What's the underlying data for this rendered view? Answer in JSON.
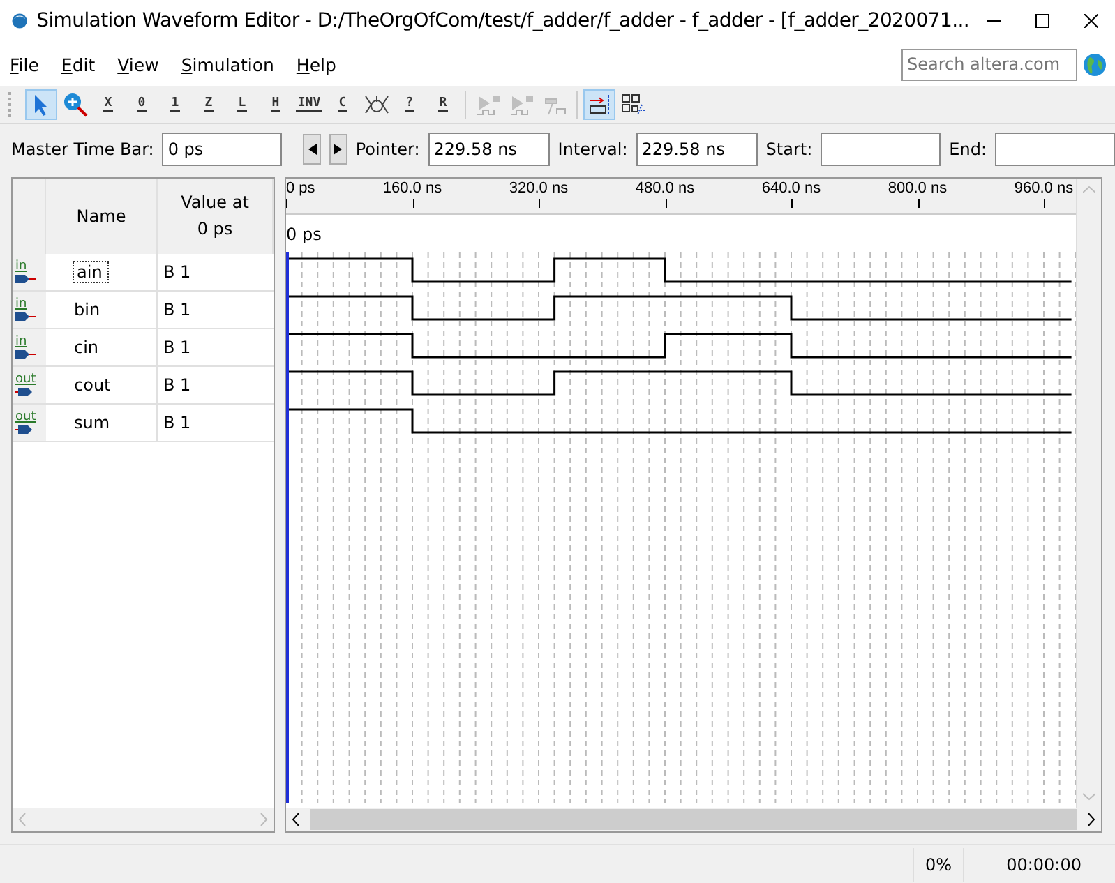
{
  "window": {
    "title": "Simulation Waveform Editor - D:/TheOrgOfCom/test/f_adder/f_adder - f_adder - [f_adder_2020071..."
  },
  "menu": [
    {
      "label": "File"
    },
    {
      "label": "Edit"
    },
    {
      "label": "View"
    },
    {
      "label": "Simulation"
    },
    {
      "label": "Help"
    }
  ],
  "search": {
    "placeholder": "Search altera.com"
  },
  "toolbar": [
    {
      "kind": "pointer",
      "selected": true,
      "disabled": false
    },
    {
      "kind": "zoom",
      "selected": false,
      "disabled": false
    },
    {
      "kind": "glyph",
      "glyph": "X",
      "selected": false,
      "disabled": false
    },
    {
      "kind": "glyph",
      "glyph": "0",
      "selected": false,
      "disabled": false
    },
    {
      "kind": "glyph",
      "glyph": "1",
      "selected": false,
      "disabled": false
    },
    {
      "kind": "glyph",
      "glyph": "Z",
      "selected": false,
      "disabled": false
    },
    {
      "kind": "glyph",
      "glyph": "L",
      "selected": false,
      "disabled": false
    },
    {
      "kind": "glyph",
      "glyph": "H",
      "selected": false,
      "disabled": false
    },
    {
      "kind": "glyph",
      "glyph": "INV",
      "selected": false,
      "disabled": false
    },
    {
      "kind": "glyph",
      "glyph": "C",
      "selected": false,
      "disabled": false
    },
    {
      "kind": "clock",
      "selected": false,
      "disabled": false
    },
    {
      "kind": "glyph",
      "glyph": "?",
      "selected": false,
      "disabled": false
    },
    {
      "kind": "glyph",
      "glyph": "R",
      "selected": false,
      "disabled": false
    },
    {
      "kind": "sep"
    },
    {
      "kind": "run",
      "selected": false,
      "disabled": true
    },
    {
      "kind": "run",
      "selected": false,
      "disabled": true
    },
    {
      "kind": "hammer",
      "selected": false,
      "disabled": true
    },
    {
      "kind": "sep"
    },
    {
      "kind": "snap",
      "selected": true,
      "disabled": false
    },
    {
      "kind": "grid",
      "selected": false,
      "disabled": false
    }
  ],
  "timebar": {
    "master_label": "Master Time Bar:",
    "master_value": "0 ps",
    "pointer_label": "Pointer:",
    "pointer_value": "229.58 ns",
    "interval_label": "Interval:",
    "interval_value": "229.58 ns",
    "start_label": "Start:",
    "end_label": "End:"
  },
  "signals_table": {
    "columns": [
      "Name",
      "Value at\n0 ps"
    ],
    "rows": [
      {
        "kind": "input",
        "pin_label": "in",
        "name": "ain",
        "value": "B 1",
        "selected": true
      },
      {
        "kind": "input",
        "pin_label": "in",
        "name": "bin",
        "value": "B 1",
        "selected": false
      },
      {
        "kind": "input",
        "pin_label": "in",
        "name": "cin",
        "value": "B 1",
        "selected": false
      },
      {
        "kind": "output",
        "pin_label": "out",
        "name": "cout",
        "value": "B 1",
        "selected": false
      },
      {
        "kind": "output",
        "pin_label": "out",
        "name": "sum",
        "value": "B 1",
        "selected": false
      }
    ]
  },
  "waveform": {
    "ruler": [
      "0 ps",
      "160.0 ns",
      "320.0 ns",
      "480.0 ns",
      "640.0 ns",
      "800.0 ns",
      "960.0 ns"
    ],
    "cursor_label": "0 ps"
  },
  "status_bar": {
    "progress": "0%",
    "elapsed": "00:00:00"
  }
}
